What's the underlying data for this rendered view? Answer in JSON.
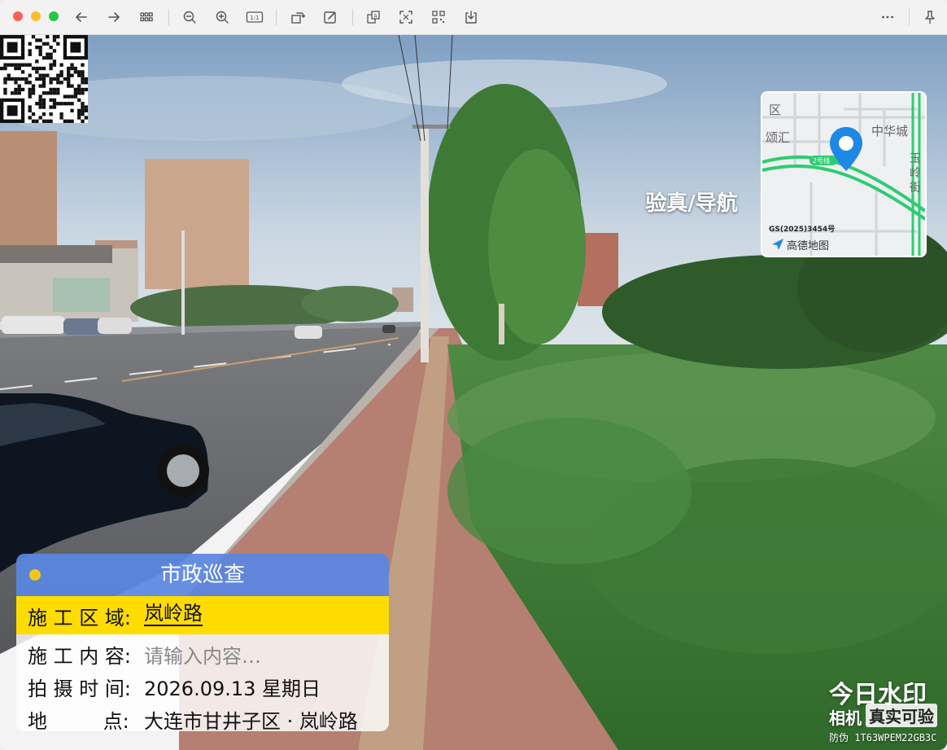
{
  "toolbar": {
    "icons": [
      "back-arrow-icon",
      "forward-arrow-icon",
      "grid-view-icon",
      "zoom-out-icon",
      "zoom-in-icon",
      "actual-size-icon",
      "rotate-icon",
      "markup-icon",
      "crop-icon",
      "ocr-icon",
      "qr-code-icon",
      "download-icon",
      "more-icon",
      "pin-icon"
    ],
    "actual_size_label": "1:1"
  },
  "watermark": {
    "qr_label": "验真/导航",
    "map": {
      "labels": [
        "区",
        "颂汇",
        "中华城",
        "玉",
        "岭",
        "街",
        "2号线"
      ],
      "license": "GS(2025)3454号",
      "brand": "高德地图"
    },
    "panel": {
      "title": "市政巡查",
      "rows": [
        {
          "label": "施 工 区 域:",
          "value": "岚岭路"
        },
        {
          "label": "施 工 内 容:",
          "value": "请输入内容…"
        },
        {
          "label": "拍 摄 时 间:",
          "value": "2026.09.13 星期日"
        },
        {
          "label": "地         点:",
          "value": "大连市甘井子区 · 岚岭路"
        }
      ]
    },
    "brand": {
      "line1": "今日水印",
      "line2a": "相机",
      "line2b": "真实可验",
      "line3": "防伪 1T63WPEM22GB3C"
    }
  },
  "colors": {
    "panel_header": "#5a87e1",
    "panel_highlight": "#ffdc00",
    "map_route": "#2ecc71",
    "map_pin": "#1e88e5"
  }
}
